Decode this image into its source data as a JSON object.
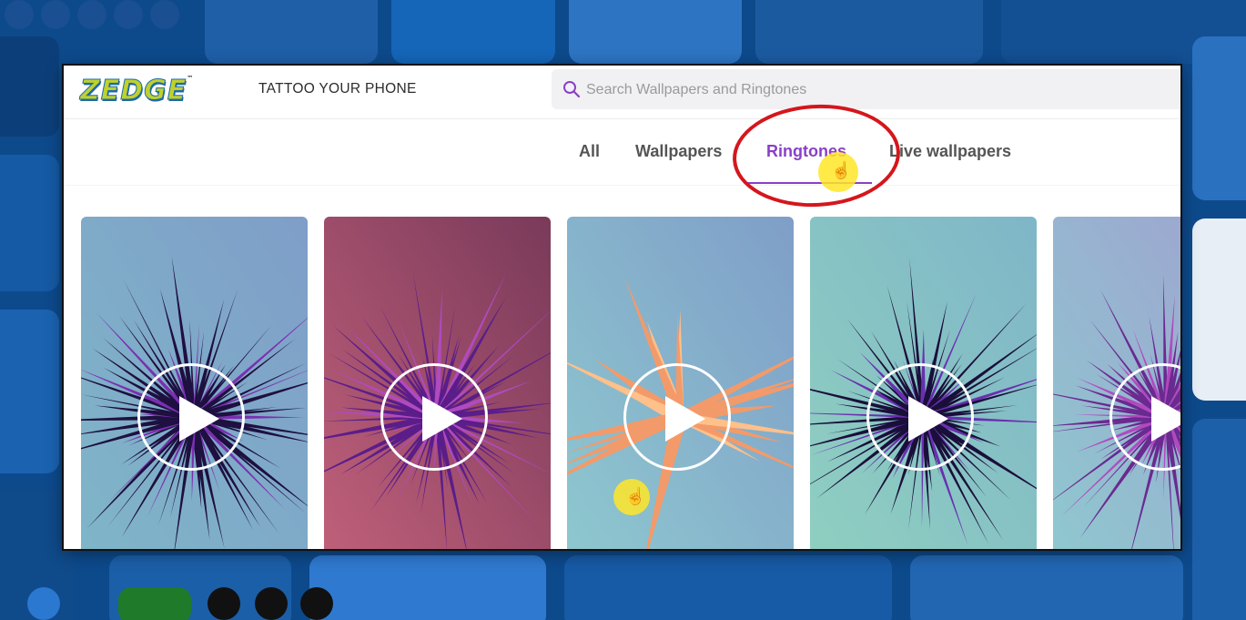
{
  "app": {
    "logo_text": "ZEDGE",
    "logo_tm": "™",
    "tagline": "TATTOO YOUR PHONE"
  },
  "search": {
    "placeholder": "Search Wallpapers and Ringtones",
    "icon": "search-icon"
  },
  "tabs": [
    {
      "label": "All",
      "active": false
    },
    {
      "label": "Wallpapers",
      "active": false
    },
    {
      "label": "Ringtones",
      "active": true
    },
    {
      "label": "Live wallpapers",
      "active": false
    }
  ],
  "annotation": {
    "circled_tab": "Ringtones",
    "circle_color": "#d5161c"
  },
  "cards": [
    {
      "bg_from": "#7fb6c8",
      "bg_to": "#7f9ec8",
      "ray_color": "#1e1040",
      "accent": "#7a2fb0",
      "icon": "play-icon"
    },
    {
      "bg_from": "#c0607a",
      "bg_to": "#7a3a5a",
      "ray_color": "#5b1d8a",
      "accent": "#b04ac0",
      "icon": "play-icon"
    },
    {
      "bg_from": "#8ec8cf",
      "bg_to": "#7f9ec8",
      "ray_color": "#f39a6a",
      "accent": "#ffc08a",
      "icon": "play-icon"
    },
    {
      "bg_from": "#8fcfc0",
      "bg_to": "#7fb6c8",
      "ray_color": "#1a0f3a",
      "accent": "#6a2fb0",
      "icon": "play-icon"
    },
    {
      "bg_from": "#8ec8cf",
      "bg_to": "#a0a0d0",
      "ray_color": "#6a2a90",
      "accent": "#b04ac0",
      "icon": "play-icon"
    }
  ],
  "colors": {
    "accent_purple": "#8b3fc8",
    "background_blue": "#0d4a8c"
  }
}
